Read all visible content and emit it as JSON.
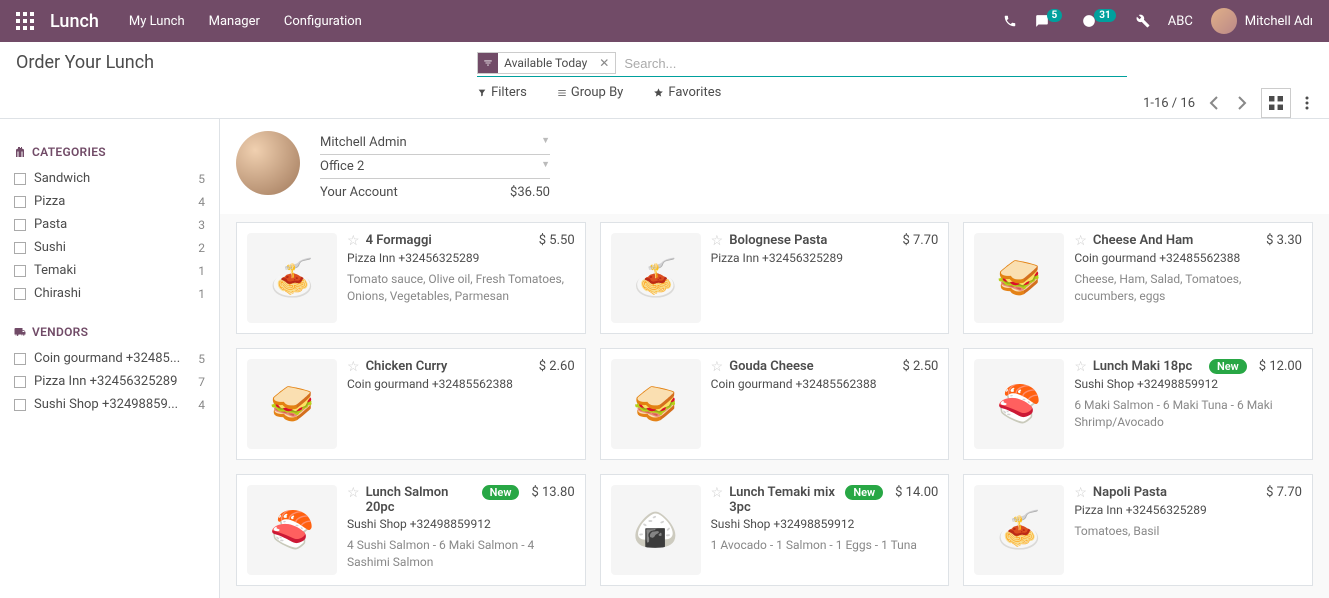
{
  "navbar": {
    "brand": "Lunch",
    "links": [
      "My Lunch",
      "Manager",
      "Configuration"
    ],
    "msg_badge": "5",
    "clock_badge": "31",
    "abc": "ABC",
    "username": "Mitchell Adı"
  },
  "page_title": "Order Your Lunch",
  "search": {
    "facet_label": "Available Today",
    "placeholder": "Search...",
    "filters_label": "Filters",
    "groupby_label": "Group By",
    "favorites_label": "Favorites"
  },
  "pager": "1-16 / 16",
  "sidebar": {
    "categories_title": "CATEGORIES",
    "categories": [
      {
        "label": "Sandwich",
        "count": "5"
      },
      {
        "label": "Pizza",
        "count": "4"
      },
      {
        "label": "Pasta",
        "count": "3"
      },
      {
        "label": "Sushi",
        "count": "2"
      },
      {
        "label": "Temaki",
        "count": "1"
      },
      {
        "label": "Chirashi",
        "count": "1"
      }
    ],
    "vendors_title": "VENDORS",
    "vendors": [
      {
        "label": "Coin gourmand +32485...",
        "count": "5"
      },
      {
        "label": "Pizza Inn +32456325289",
        "count": "7"
      },
      {
        "label": "Sushi Shop +32498859...",
        "count": "4"
      }
    ]
  },
  "account": {
    "user": "Mitchell Admin",
    "location": "Office 2",
    "account_label": "Your Account",
    "balance": "$36.50"
  },
  "products": [
    {
      "name": "4 Formaggi",
      "vendor": "Pizza Inn +32456325289",
      "desc": "Tomato sauce, Olive oil, Fresh Tomatoes, Onions, Vegetables, Parmesan",
      "price": "$ 5.50",
      "emoji": "🍝"
    },
    {
      "name": "Bolognese Pasta",
      "vendor": "Pizza Inn +32456325289",
      "desc": "",
      "price": "$ 7.70",
      "emoji": "🍝"
    },
    {
      "name": "Cheese And Ham",
      "vendor": "Coin gourmand +32485562388",
      "desc": "Cheese, Ham, Salad, Tomatoes, cucumbers, eggs",
      "price": "$ 3.30",
      "emoji": "🥪"
    },
    {
      "name": "Chicken Curry",
      "vendor": "Coin gourmand +32485562388",
      "desc": "",
      "price": "$ 2.60",
      "emoji": "🥪"
    },
    {
      "name": "Gouda Cheese",
      "vendor": "Coin gourmand +32485562388",
      "desc": "",
      "price": "$ 2.50",
      "emoji": "🥪"
    },
    {
      "name": "Lunch Maki 18pc",
      "vendor": "Sushi Shop +32498859912",
      "desc": "6 Maki Salmon - 6 Maki Tuna - 6 Maki Shrimp/Avocado",
      "price": "$ 12.00",
      "new": "New",
      "emoji": "🍣"
    },
    {
      "name": "Lunch Salmon 20pc",
      "vendor": "Sushi Shop +32498859912",
      "desc": "4 Sushi Salmon - 6 Maki Salmon - 4 Sashimi Salmon",
      "price": "$ 13.80",
      "new": "New",
      "emoji": "🍣"
    },
    {
      "name": "Lunch Temaki mix 3pc",
      "vendor": "Sushi Shop +32498859912",
      "desc": "1 Avocado - 1 Salmon - 1 Eggs - 1 Tuna",
      "price": "$ 14.00",
      "new": "New",
      "emoji": "🍙"
    },
    {
      "name": "Napoli Pasta",
      "vendor": "Pizza Inn +32456325289",
      "desc": "Tomatoes, Basil",
      "price": "$ 7.70",
      "emoji": "🍝"
    }
  ]
}
